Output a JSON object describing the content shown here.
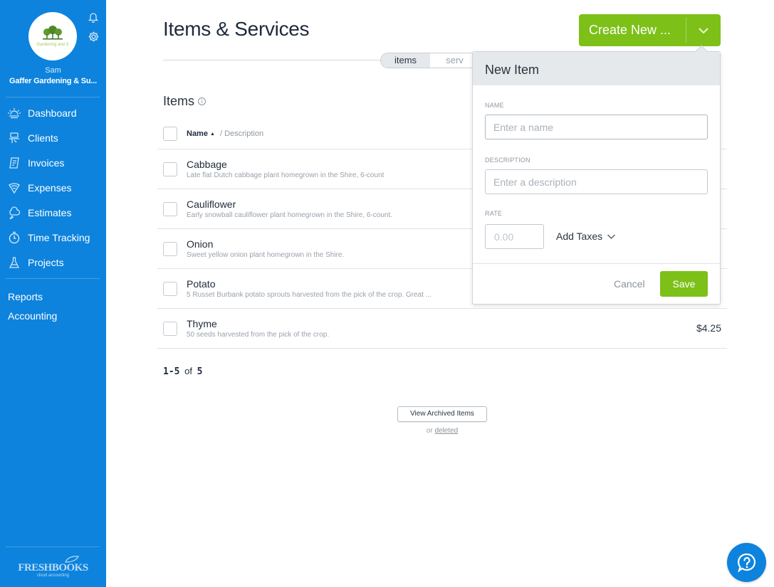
{
  "sidebar": {
    "avatar_text": "Gardening and S",
    "user_name": "Sam",
    "company": "Gaffer Gardening & Su...",
    "nav": [
      {
        "label": "Dashboard",
        "icon": "dashboard-icon"
      },
      {
        "label": "Clients",
        "icon": "clients-icon"
      },
      {
        "label": "Invoices",
        "icon": "invoices-icon"
      },
      {
        "label": "Expenses",
        "icon": "expenses-icon"
      },
      {
        "label": "Estimates",
        "icon": "estimates-icon"
      },
      {
        "label": "Time Tracking",
        "icon": "stopwatch-icon"
      },
      {
        "label": "Projects",
        "icon": "flask-icon"
      }
    ],
    "secondary": [
      {
        "label": "Reports"
      },
      {
        "label": "Accounting"
      }
    ],
    "brand": "FRESHBOOKS",
    "brand_tag": "cloud accounting",
    "color": "#0d83dd"
  },
  "header": {
    "title": "Items & Services",
    "toggle": {
      "items": "items",
      "services": "serv"
    },
    "create_label": "Create New ...",
    "accent": "#7cc018"
  },
  "items_section": {
    "heading": "Items",
    "col_name": "Name",
    "col_desc": "Description",
    "rows": [
      {
        "name": "Cabbage",
        "desc": "Late flat Dutch cabbage plant homegrown in the Shire, 6-count",
        "price": ""
      },
      {
        "name": "Cauliflower",
        "desc": "Early snowball cauliflower plant homegrown in the Shire, 6-count.",
        "price": ""
      },
      {
        "name": "Onion",
        "desc": "Sweet yellow onion plant homegrown in the Shire.",
        "price": ""
      },
      {
        "name": "Potato",
        "desc": "5 Russet Burbank potato sprouts harvested from the pick of the crop. Great ...",
        "price": ""
      },
      {
        "name": "Thyme",
        "desc": "50 seeds harvested from the pick of the crop.",
        "price": "$4.25"
      }
    ],
    "pager": {
      "range": "1-5",
      "of": "of",
      "total": "5"
    },
    "archived_label": "View Archived Items",
    "or_text": "or",
    "deleted_link": "deleted"
  },
  "popover": {
    "title": "New Item",
    "name_label": "NAME",
    "name_placeholder": "Enter a name",
    "desc_label": "DESCRIPTION",
    "desc_placeholder": "Enter a description",
    "rate_label": "RATE",
    "rate_placeholder": "0.00",
    "add_taxes": "Add Taxes",
    "cancel": "Cancel",
    "save": "Save"
  }
}
